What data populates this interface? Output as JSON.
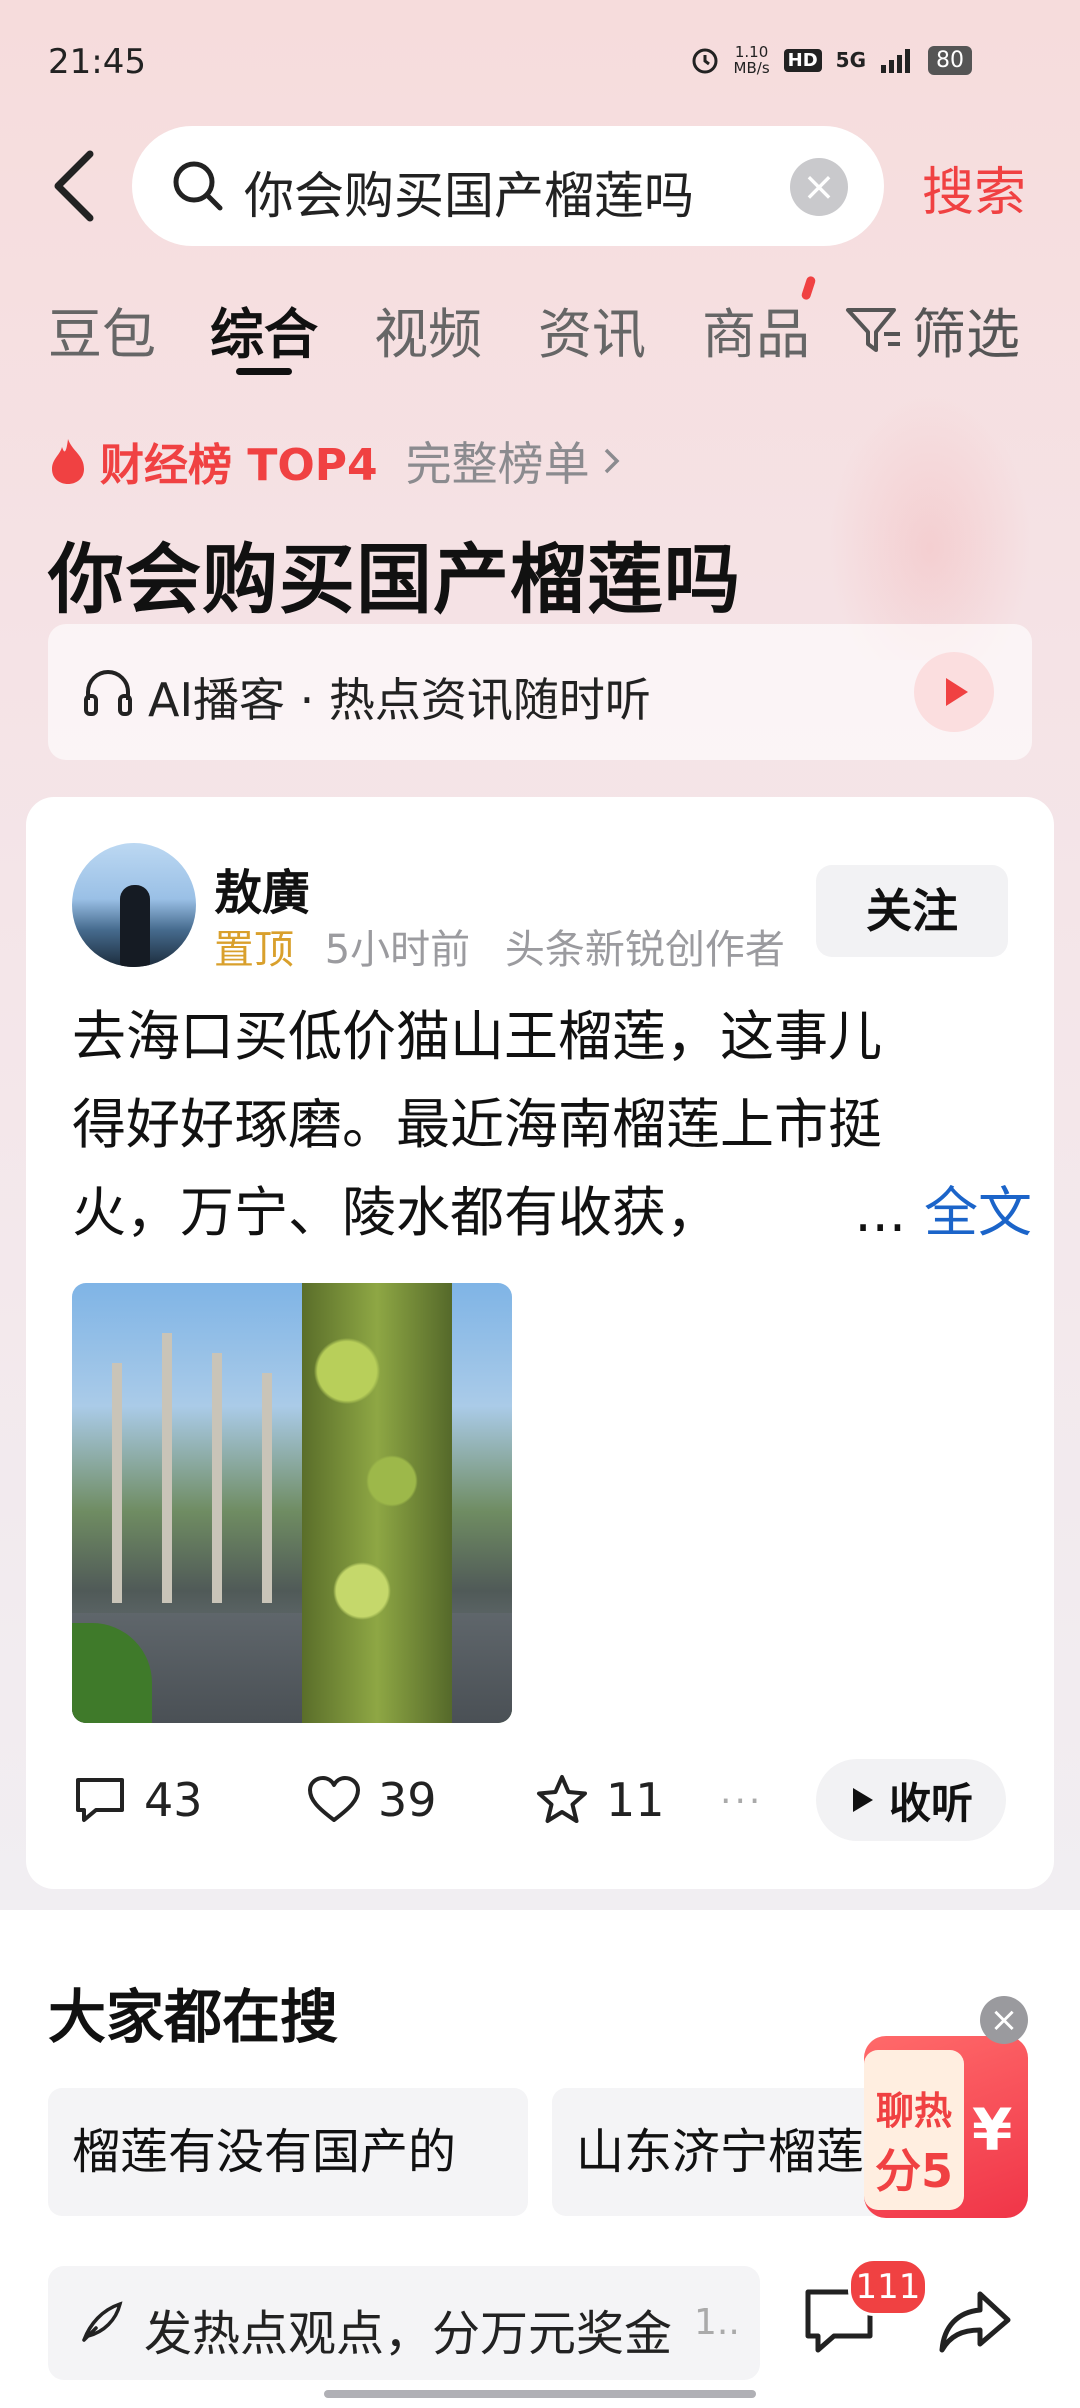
{
  "status_bar": {
    "time": "21:45",
    "net_speed_value": "1.10",
    "net_speed_unit": "MB/s",
    "hd": "HD",
    "signal": "5G",
    "battery": "80"
  },
  "search": {
    "query": "你会购买国产榴莲吗",
    "submit_label": "搜索"
  },
  "tabs": [
    "豆包",
    "综合",
    "视频",
    "资讯",
    "商品"
  ],
  "active_tab": "综合",
  "filter_label": "筛选",
  "ranking": {
    "label": "财经榜 TOP4",
    "more": "完整榜单"
  },
  "headline": "你会购买国产榴莲吗",
  "podcast": {
    "label": "AI播客 · 热点资讯随时听"
  },
  "post": {
    "author": "敖廣",
    "pinned": "置顶",
    "time": "5小时前",
    "role": "头条新锐创作者",
    "follow": "关注",
    "lines": [
      "去海口买低价猫山王榴莲，这事儿",
      "得好好琢磨。最近海南榴莲上市挺",
      "火，万宁、陵水都有收获，"
    ],
    "ellipsis": "...",
    "full_text": "全文",
    "comments": "43",
    "likes": "39",
    "favorites": "11",
    "more": "···",
    "listen": "收听"
  },
  "related": {
    "title": "大家都在搜",
    "items": [
      "榴莲有没有国产的",
      "山东济宁榴莲"
    ]
  },
  "bottom_bar": {
    "placeholder": "发热点观点，分万元奖金",
    "counter": "1..",
    "comment_count": "111"
  },
  "float_ad": {
    "line1": "聊热",
    "line2": "分5",
    "yen": "¥"
  },
  "colors": {
    "accent": "#f04142",
    "link": "#1b64c9",
    "pin": "#d9a02c"
  }
}
